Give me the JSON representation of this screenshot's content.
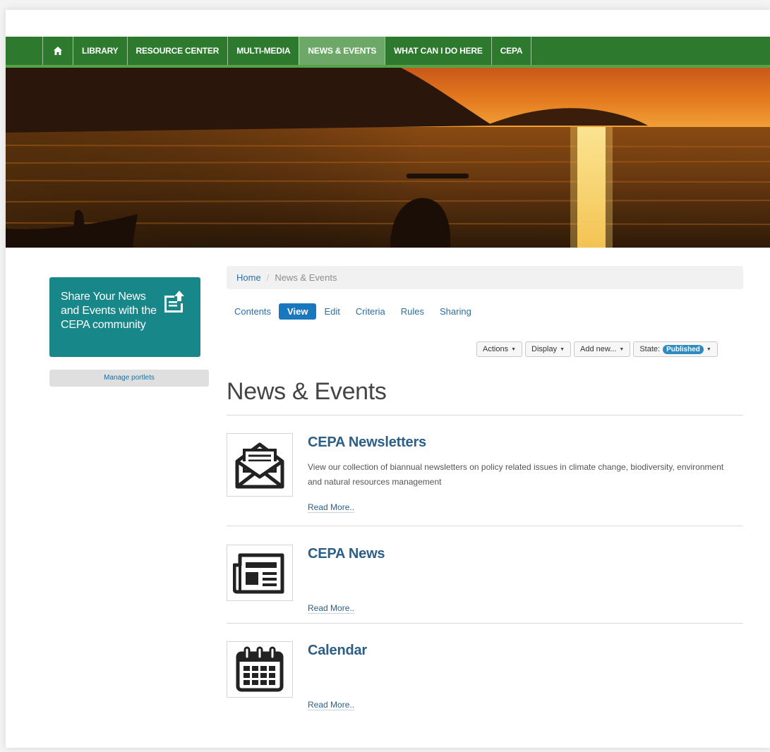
{
  "nav": {
    "home_icon": "home-icon",
    "items": [
      {
        "label": "LIBRARY"
      },
      {
        "label": "RESOURCE CENTER"
      },
      {
        "label": "MULTI-MEDIA"
      },
      {
        "label": "NEWS & EVENTS",
        "active": true
      },
      {
        "label": "WHAT CAN I DO HERE"
      },
      {
        "label": "CEPA"
      }
    ]
  },
  "sidebar": {
    "share_text": "Share Your News and Events with the CEPA community",
    "share_icon": "share-upload-icon",
    "manage_portlets": "Manage portlets"
  },
  "breadcrumb": {
    "home": "Home",
    "separator": "/",
    "current": "News & Events"
  },
  "tabs": [
    {
      "label": "Contents"
    },
    {
      "label": "View",
      "active": true
    },
    {
      "label": "Edit"
    },
    {
      "label": "Criteria"
    },
    {
      "label": "Rules"
    },
    {
      "label": "Sharing"
    }
  ],
  "toolbar": {
    "actions": "Actions",
    "display": "Display",
    "add_new": "Add new...",
    "state_label": "State:",
    "state_value": "Published"
  },
  "page": {
    "title": "News & Events"
  },
  "items": [
    {
      "title": "CEPA Newsletters",
      "description": "View our collection of biannual newsletters on policy related issues in climate change, biodiversity, environment and natural resources management",
      "read_more": "Read More..",
      "icon": "envelope-icon"
    },
    {
      "title": "CEPA News",
      "description": "",
      "read_more": "Read More..",
      "icon": "newspaper-icon"
    },
    {
      "title": "Calendar",
      "description": "",
      "read_more": "Read More..",
      "icon": "calendar-icon"
    }
  ],
  "colors": {
    "nav_green": "#2d7a2e",
    "nav_active": "#6ea868",
    "share_teal": "#17878a",
    "link_blue": "#2a6fa6",
    "title_blue": "#2c5f86",
    "tab_active": "#1978bd"
  }
}
